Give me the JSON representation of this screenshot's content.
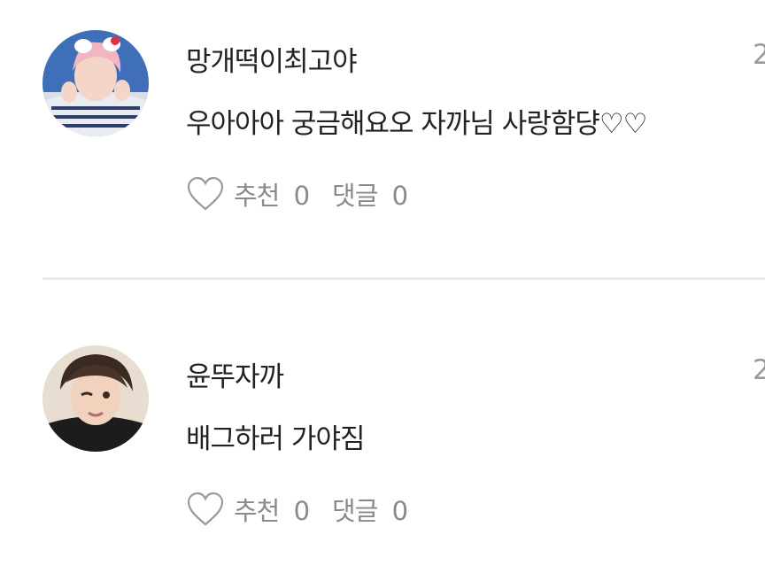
{
  "comments": [
    {
      "author": "망개떡이최고야",
      "text": "우아아아 궁금해요오 자까님 사랑함댱♡♡",
      "time_fragment": "2",
      "like_label": "추천",
      "like_count": "0",
      "reply_label": "댓글",
      "reply_count": "0",
      "icons": {
        "like": "heart-outline-icon"
      }
    },
    {
      "author": "윤뚜자까",
      "text": "배그하러 가야짐",
      "time_fragment": "2",
      "like_label": "추천",
      "like_count": "0",
      "reply_label": "댓글",
      "reply_count": "0",
      "icons": {
        "like": "heart-outline-icon"
      }
    }
  ],
  "colors": {
    "text": "#222222",
    "muted": "#8a8a8a",
    "divider": "#e8eeec"
  }
}
